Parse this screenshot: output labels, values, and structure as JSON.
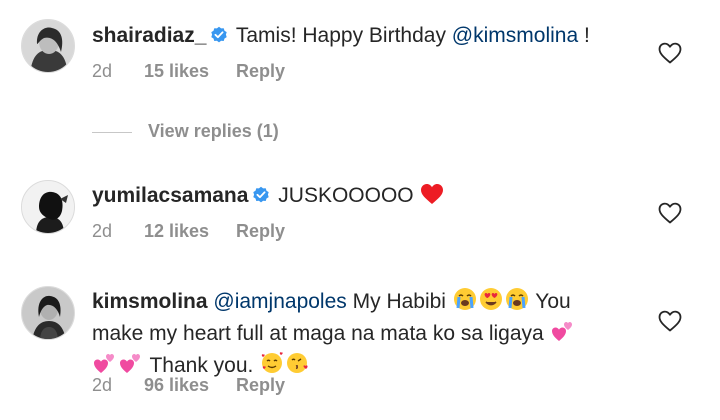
{
  "colors": {
    "text": "#262626",
    "secondary": "#8e8e8e",
    "mention": "#00376b",
    "verified": "#3897f0",
    "heart_red": "#ed4956"
  },
  "comments": [
    {
      "username": "shairadiaz_",
      "verified": true,
      "text_before": "Tamis! Happy Birthday ",
      "mention": "@kimsmolina",
      "text_after": " !",
      "time": "2d",
      "likes": "15 likes",
      "reply": "Reply",
      "avatar_icon": "avatar-photo-icon"
    },
    {
      "username": "yumilacsamana",
      "verified": true,
      "text_before": "JUSKOOOOO ",
      "emoji": [
        "red-heart-emoji"
      ],
      "time": "2d",
      "likes": "12 likes",
      "reply": "Reply",
      "avatar_icon": "avatar-photo-icon"
    },
    {
      "username": "kimsmolina",
      "verified": false,
      "mention": "@iamjnapoles",
      "text_part1": " My Habibi ",
      "text_part2": " You make my heart full at maga na mata ko sa ligaya ",
      "text_part3": " Thank you. ",
      "emoji": [
        "loudly-crying-face-emoji",
        "heart-eyes-emoji",
        "loudly-crying-face-emoji",
        "two-hearts-emoji",
        "two-hearts-emoji",
        "two-hearts-emoji",
        "smiling-face-with-hearts-emoji",
        "face-blowing-kiss-emoji"
      ],
      "time": "2d",
      "likes": "96 likes",
      "reply": "Reply",
      "avatar_icon": "avatar-photo-icon"
    }
  ],
  "view_replies": "View replies (1)",
  "icons": {
    "like": "heart-outline-icon",
    "verified": "verified-badge-icon"
  }
}
